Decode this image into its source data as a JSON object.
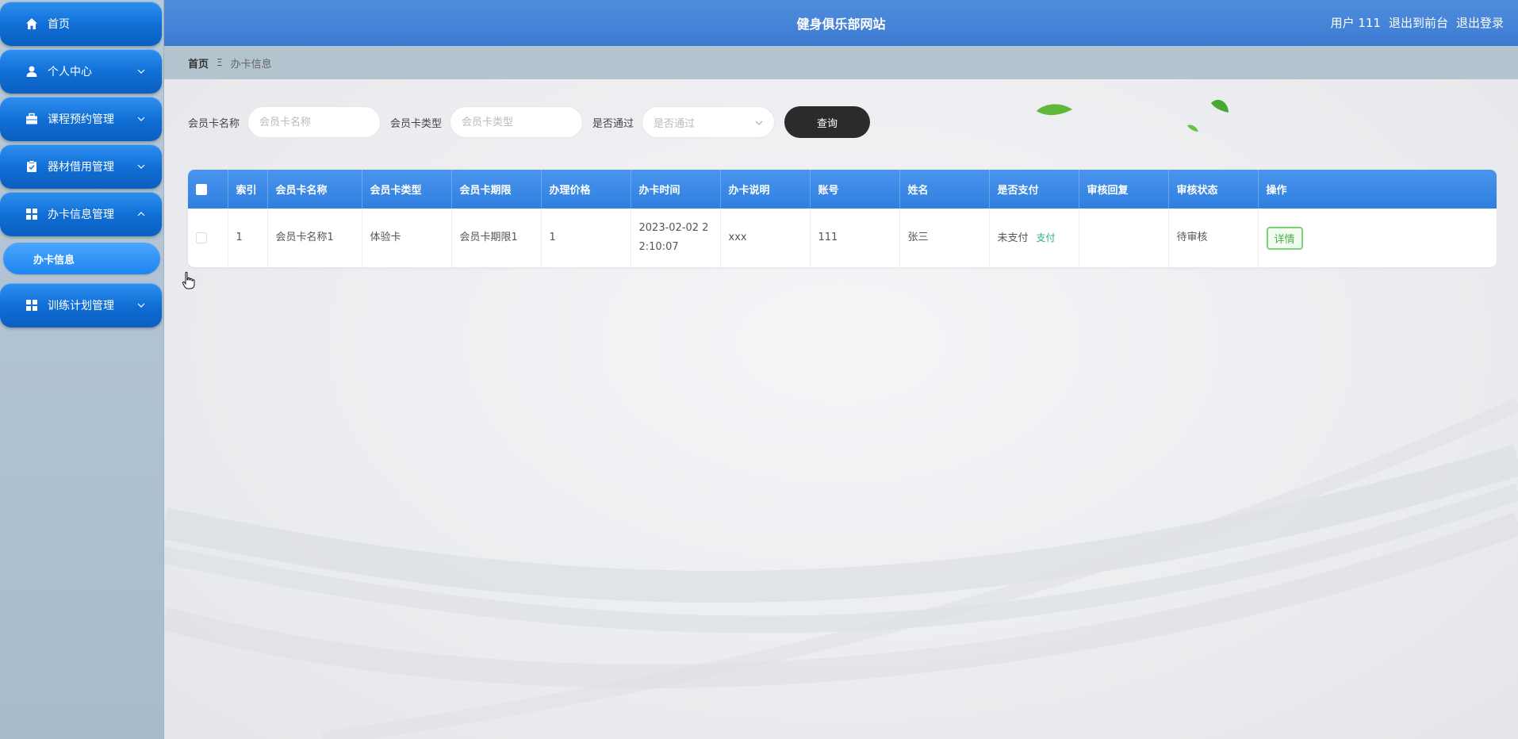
{
  "header": {
    "title": "健身俱乐部网站",
    "user": "用户 111",
    "to_front": "退出到前台",
    "logout": "退出登录"
  },
  "sidebar": {
    "items": [
      {
        "label": "首页",
        "icon": "home-icon"
      },
      {
        "label": "个人中心",
        "icon": "user-icon"
      },
      {
        "label": "课程预约管理",
        "icon": "briefcase-icon"
      },
      {
        "label": "器材借用管理",
        "icon": "clipboard-icon"
      },
      {
        "label": "办卡信息管理",
        "icon": "grid-icon"
      },
      {
        "label": "训练计划管理",
        "icon": "grid-icon"
      }
    ],
    "sub_item": "办卡信息"
  },
  "breadcrumb": {
    "home": "首页",
    "separator": "Ξ",
    "current": "办卡信息"
  },
  "search": {
    "name_label": "会员卡名称",
    "name_placeholder": "会员卡名称",
    "type_label": "会员卡类型",
    "type_placeholder": "会员卡类型",
    "pass_label": "是否通过",
    "pass_placeholder": "是否通过",
    "query_button": "查询"
  },
  "table": {
    "columns": [
      "索引",
      "会员卡名称",
      "会员卡类型",
      "会员卡期限",
      "办理价格",
      "办卡时间",
      "办卡说明",
      "账号",
      "姓名",
      "是否支付",
      "审核回复",
      "审核状态",
      "操作"
    ],
    "rows": [
      {
        "index": "1",
        "card_name": "会员卡名称1",
        "card_type": "体验卡",
        "card_term": "会员卡期限1",
        "price": "1",
        "time": "2023-02-02 22:10:07",
        "note": "xxx",
        "account": "111",
        "name": "张三",
        "paid": "未支付",
        "pay_action": "支付",
        "reply": "",
        "status": "待审核",
        "action": "详情"
      }
    ]
  },
  "colors": {
    "header_bg": "#3c7bd3",
    "menu_blue": "#0f6dd4",
    "query_button": "#2b2b2b",
    "detail_green": "#4cae4c",
    "pay_green": "#2ab27b"
  }
}
